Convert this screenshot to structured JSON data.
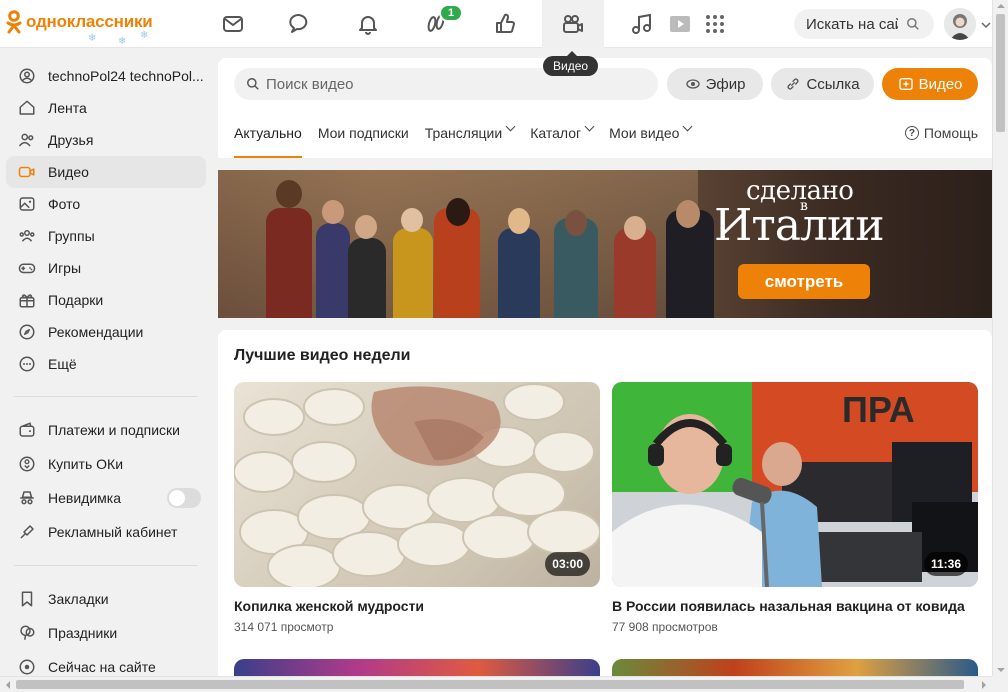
{
  "brand": {
    "name": "одноклассники",
    "color": "#ee8208"
  },
  "topnav": {
    "items": [
      {
        "icon": "mail-icon"
      },
      {
        "icon": "chat-icon"
      },
      {
        "icon": "bell-icon"
      },
      {
        "icon": "guests-icon",
        "badge": "1"
      },
      {
        "icon": "like-icon"
      },
      {
        "icon": "video-camera-icon",
        "active": true
      },
      {
        "icon": "music-icon"
      },
      {
        "icon": "play-icon"
      },
      {
        "icon": "apps-grid-icon"
      }
    ],
    "tooltip": "Видео",
    "search_placeholder": "Искать на сайте"
  },
  "sidebar": {
    "items": [
      {
        "label": "technoPol24 technoPol...",
        "icon": "profile-icon"
      },
      {
        "label": "Лента",
        "icon": "home-icon"
      },
      {
        "label": "Друзья",
        "icon": "friends-icon"
      },
      {
        "label": "Видео",
        "icon": "video-icon",
        "active": true
      },
      {
        "label": "Фото",
        "icon": "photo-icon"
      },
      {
        "label": "Группы",
        "icon": "groups-icon"
      },
      {
        "label": "Игры",
        "icon": "games-icon"
      },
      {
        "label": "Подарки",
        "icon": "gift-icon"
      },
      {
        "label": "Рекомендации",
        "icon": "compass-icon"
      },
      {
        "label": "Ещё",
        "icon": "more-icon"
      }
    ],
    "items2": [
      {
        "label": "Платежи и подписки",
        "icon": "wallet-icon"
      },
      {
        "label": "Купить ОКи",
        "icon": "ok-coin-icon"
      },
      {
        "label": "Невидимка",
        "icon": "incognito-icon",
        "toggle": false
      },
      {
        "label": "Рекламный кабинет",
        "icon": "megaphone-icon"
      }
    ],
    "items3": [
      {
        "label": "Закладки",
        "icon": "bookmark-icon"
      },
      {
        "label": "Праздники",
        "icon": "balloon-icon"
      },
      {
        "label": "Сейчас на сайте",
        "icon": "online-icon"
      }
    ]
  },
  "video_header": {
    "search_placeholder": "Поиск видео",
    "live_label": "Эфир",
    "link_label": "Ссылка",
    "upload_label": "Видео",
    "tabs": [
      "Актуально",
      "Мои подписки",
      "Трансляции",
      "Каталог",
      "Мои видео"
    ],
    "active_tab": "Актуально",
    "help_label": "Помощь"
  },
  "banner": {
    "title_line1": "сделано",
    "title_small": "в",
    "title_line2": "Италии",
    "button": "смотреть"
  },
  "section": {
    "heading": "Лучшие видео недели",
    "videos": [
      {
        "title": "Копилка женской мудрости",
        "views": "314 071 просмотр",
        "duration": "03:00"
      },
      {
        "title": "В России появилась назальная вакцина от ковида",
        "views": "77 908 просмотров",
        "duration": "11:36"
      }
    ]
  }
}
